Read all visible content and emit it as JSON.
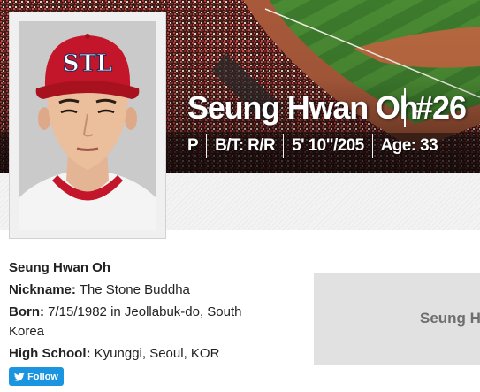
{
  "player": {
    "name": "Seung Hwan Oh",
    "number": "#26",
    "position": "P",
    "bats_throws": "B/T: R/R",
    "height_weight": "5' 10\"/205",
    "age": "Age: 33",
    "cap_logo": "STL"
  },
  "bio": {
    "full_name": "Seung Hwan Oh",
    "nickname_label": "Nickname:",
    "nickname_value": "The Stone Buddha",
    "born_label": "Born:",
    "born_value": "7/15/1982 in Jeollabuk-do, South Korea",
    "high_school_label": "High School:",
    "high_school_value": "Kyunggi, Seoul, KOR"
  },
  "social": {
    "follow_label": "Follow",
    "icon": "twitter-bird-icon"
  },
  "side_panel": {
    "text": "Seung H"
  },
  "colors": {
    "twitter_blue": "#1b95e0",
    "cap_red": "#c4162a",
    "placeholder_gray": "#e1e1e1",
    "field_green": "#3c7a2c",
    "dirt": "#a8593a"
  }
}
